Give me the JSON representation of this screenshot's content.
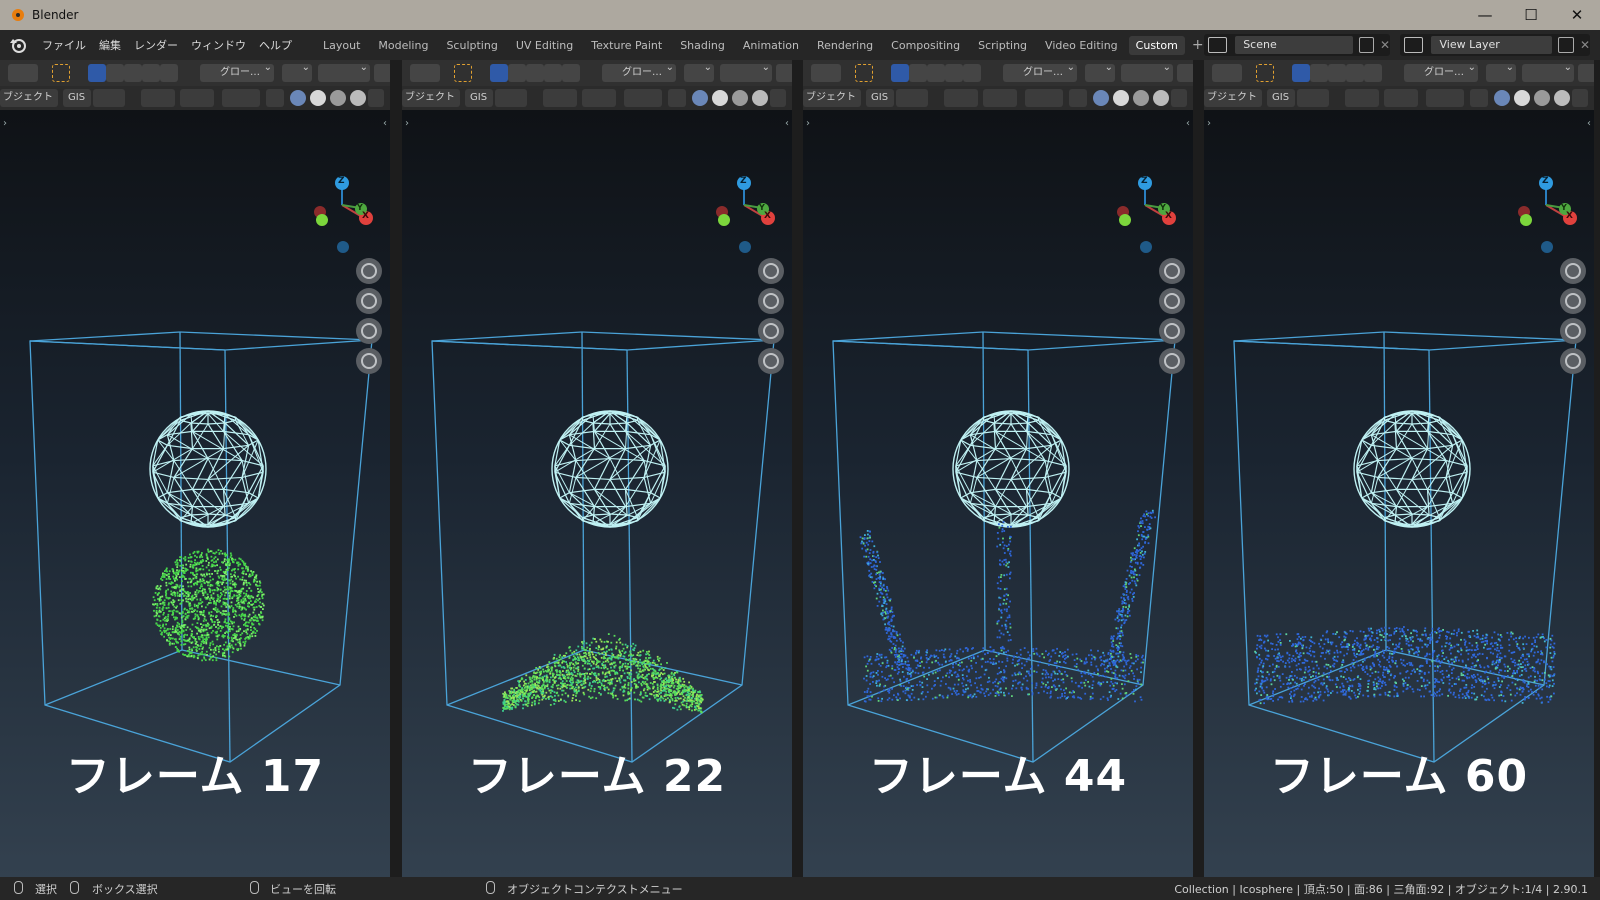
{
  "window": {
    "title": "Blender",
    "minimize": "—",
    "maximize": "☐",
    "close": "✕"
  },
  "menu": [
    "ファイル",
    "編集",
    "レンダー",
    "ウィンドウ",
    "ヘルプ"
  ],
  "workspaces": [
    "Layout",
    "Modeling",
    "Sculpting",
    "UV Editing",
    "Texture Paint",
    "Shading",
    "Animation",
    "Rendering",
    "Compositing",
    "Scripting",
    "Video Editing",
    "Custom"
  ],
  "active_workspace": "Custom",
  "add_workspace": "+",
  "scene": {
    "name": "Scene",
    "view_layer": "View Layer"
  },
  "header": {
    "transform": "グロー…",
    "object_menu": "ブジェクト",
    "gis": "GIS"
  },
  "viewports": [
    {
      "label": "フレーム 17",
      "particle_state": "sphere",
      "color": "#4fd44a"
    },
    {
      "label": "フレーム 22",
      "particle_state": "dome",
      "color": "#5fdc5a"
    },
    {
      "label": "フレーム 44",
      "particle_state": "splash",
      "color": "#2f6fe0"
    },
    {
      "label": "フレーム 60",
      "particle_state": "pool",
      "color": "#2f6fe0"
    }
  ],
  "gizmo": {
    "z": "Z",
    "y": "Y",
    "x": "X"
  },
  "status": {
    "select": "選択",
    "box_select": "ボックス選択",
    "rotate_view": "ビューを回転",
    "context_menu": "オブジェクトコンテクストメニュー",
    "info": "Collection | Icosphere | 頂点:50 | 面:86 | 三角面:92 | オブジェクト:1/4 | 2.90.1"
  }
}
